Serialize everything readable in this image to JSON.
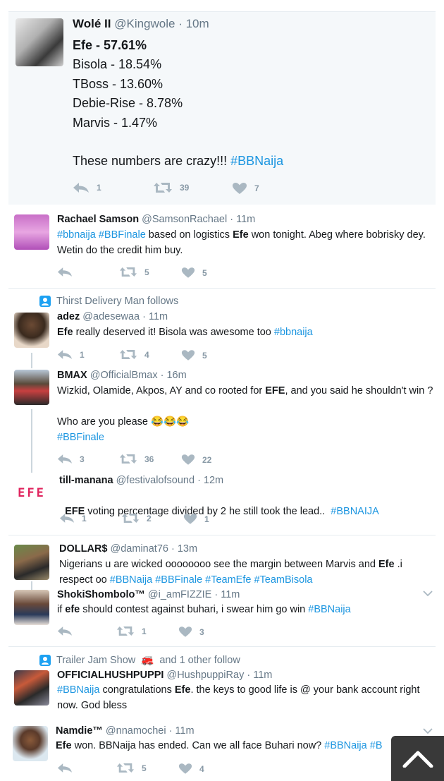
{
  "tweets": {
    "t1": {
      "name": "Wolé II",
      "handle": "@Kingwole",
      "time": "· 10m",
      "lines": [
        "Efe - 57.61%",
        "Bisola - 18.54%",
        "TBoss - 13.60%",
        "Debie-Rise - 8.78%",
        "Marvis - 1.47%"
      ],
      "closing_text": "These numbers are crazy!!! ",
      "closing_tag": "#BBNaija",
      "replies": "1",
      "retweets": "39",
      "likes": "7"
    },
    "t2": {
      "name": "Rachael Samson",
      "handle": "@SamsonRachael",
      "time": "· 11m",
      "tag1": "#bbnaija",
      "tag2": "#BBFinale",
      "text_a": " based on logistics ",
      "bold": "Efe",
      "text_b": " won tonight. Abeg where bobrisky dey. Wetin do the credit him buy.",
      "replies": "",
      "retweets": "5",
      "likes": "5"
    },
    "t3": {
      "social": "Thirst Delivery Man follows",
      "name": "adez",
      "handle": "@adesewaa",
      "time": "· 11m",
      "bold": "Efe",
      "text": " really deserved it! Bisola was awesome too ",
      "tag": "#bbnaija",
      "replies": "1",
      "retweets": "4",
      "likes": "5"
    },
    "t4": {
      "name": "BMAX",
      "handle": "@OfficialBmax",
      "time": "· 16m",
      "text_a": "Wizkid, Olamide, Akpos, AY and co rooted for ",
      "bold": "EFE",
      "text_b": ", and you said he shouldn't win ?",
      "line2": "Who are you please ",
      "emoji": "😂😂😂",
      "tag": "#BBFinale",
      "replies": "3",
      "retweets": "36",
      "likes": "22"
    },
    "t5": {
      "name": "till-manana",
      "handle": "@festivalofsound",
      "time": "· 12m",
      "avatar_text": "EFE",
      "bold": "EFE",
      "text": " voting percentage divided by 2 he still took the lead..  ",
      "tag": "#BBNAIJA",
      "replies": "1",
      "retweets": "2",
      "likes": "1"
    },
    "t6": {
      "name": "DOLLAR$",
      "handle": "@daminat76",
      "time": "· 13m",
      "text_a": "Nigerians u are wicked oooooooo see the margin between Marvis and ",
      "bold": "Efe",
      "text_b": " .i respect oo ",
      "tags": "#BBNaija #BBFinale #TeamEfe #TeamBisola"
    },
    "t7": {
      "name": "ShokiShombolo™",
      "handle": "@i_amFIZZIE",
      "time": "· 11m",
      "text_a": "if ",
      "bold": "efe",
      "text_b": " should contest against buhari, i swear him go win ",
      "tag": "#BBNaija",
      "replies": "",
      "retweets": "1",
      "likes": "3"
    },
    "t8": {
      "social": "Trailer Jam Show",
      "social_emoji": "🚒",
      "social_rest": "and 1 other follow",
      "name": "OFFICIALHUSHPUPPI",
      "handle": "@HushpuppiRay",
      "time": "· 11m",
      "tag": "#BBNaija",
      "text_a": " congratulations ",
      "bold": "Efe",
      "text_b": ". the keys to good life is @ your bank account right now.  God bless"
    },
    "t9": {
      "name": "Namdie™",
      "handle": "@nnamochei",
      "time": "· 11m",
      "bold": "Efe",
      "text": " won. BBNaija has ended. Can we all face Buhari now? ",
      "tag": "#BBNaija",
      "tag_cut": "#B",
      "replies": "",
      "retweets": "5",
      "likes": "4"
    }
  },
  "icons": {
    "reply": "reply-icon",
    "retweet": "retweet-icon",
    "like": "heart-icon",
    "follow": "person-icon",
    "chevron": "chevron-down-icon",
    "scroll_top": "scroll-top-icon"
  },
  "colors": {
    "link": "#1b95e0",
    "muted": "#657786",
    "action": "#8899a6",
    "highlight_bg": "#f5f8fa"
  }
}
